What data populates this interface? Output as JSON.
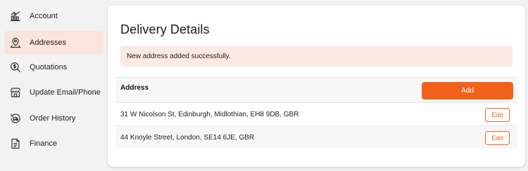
{
  "sidebar": {
    "items": [
      {
        "label": "Account",
        "icon": "chart-bars-icon",
        "active": false
      },
      {
        "label": "Addresses",
        "icon": "location-pin-icon",
        "active": true
      },
      {
        "label": "Quotations",
        "icon": "search-dollar-icon",
        "active": false
      },
      {
        "label": "Update Email/Phone",
        "icon": "store-icon",
        "active": false
      },
      {
        "label": "Order History",
        "icon": "history-truck-icon",
        "active": false
      },
      {
        "label": "Finance",
        "icon": "document-icon",
        "active": false
      }
    ]
  },
  "main": {
    "title": "Delivery Details",
    "alert": "New address added successfully.",
    "table": {
      "header": "Address",
      "add_label": "Add",
      "rows": [
        {
          "address": "31 W Nicolson St, Edinburgh, Midlothian, EH8 9DB, GBR",
          "edit_label": "Edit"
        },
        {
          "address": "44 Knoyle Street, London, SE14 6JE, GBR",
          "edit_label": "Edit"
        }
      ]
    }
  },
  "colors": {
    "accent": "#f0621a",
    "active_bg": "#fbe4db",
    "alert_bg": "#fbe9e3"
  }
}
